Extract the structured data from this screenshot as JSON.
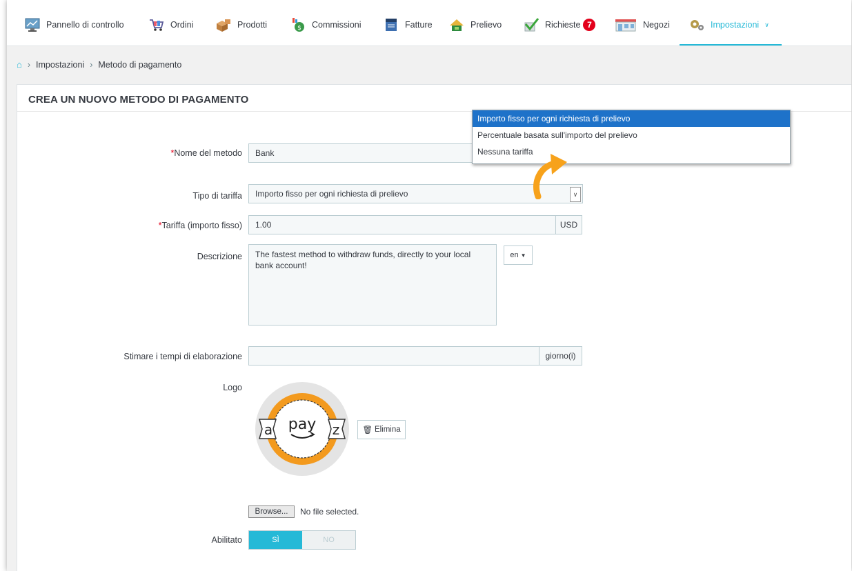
{
  "nav": {
    "items": [
      {
        "label": "Pannello di controllo",
        "icon": "dashboard-icon"
      },
      {
        "label": "Ordini",
        "icon": "cart-icon"
      },
      {
        "label": "Prodotti",
        "icon": "boxes-icon"
      },
      {
        "label": "Commissioni",
        "icon": "money-bag-icon"
      },
      {
        "label": "Fatture",
        "icon": "invoice-icon"
      },
      {
        "label": "Prelievo",
        "icon": "withdraw-icon"
      },
      {
        "label": "Richieste",
        "icon": "checkmark-icon",
        "badge": "7"
      },
      {
        "label": "Negozi",
        "icon": "store-icon"
      },
      {
        "label": "Impostazioni",
        "icon": "gears-icon",
        "active": true
      }
    ]
  },
  "breadcrumb": {
    "items": [
      "Impostazioni",
      "Metodo di pagamento"
    ]
  },
  "panel": {
    "title": "CREA UN NUOVO METODO DI PAGAMENTO"
  },
  "form": {
    "name_label": "Nome del metodo",
    "name_value": "Bank",
    "fee_type_label": "Tipo di tariffa",
    "fee_type_value": "Importo fisso per ogni richiesta di prelievo",
    "fee_label": "Tariffa (importo fisso)",
    "fee_value": "1.00",
    "fee_unit": "USD",
    "desc_label": "Descrizione",
    "desc_value": "The fastest method to withdraw funds, directly to your local bank account!",
    "lang": "en",
    "time_label": "Stimare i tempi di elaborazione",
    "time_value": "",
    "time_unit": "giorno(i)",
    "logo_label": "Logo",
    "logo_text": "pay",
    "logo_left": "a",
    "logo_right": "z",
    "delete_label": "Elimina",
    "browse_label": "Browse...",
    "no_file": "No file selected.",
    "enabled_label": "Abilitato",
    "yes_label": "SÌ",
    "no_label": "NO"
  },
  "dropdown": {
    "options": [
      "Importo fisso per ogni richiesta di prelievo",
      "Percentuale basata sull'importo del prelievo",
      "Nessuna tariffa"
    ],
    "selected_index": 0
  },
  "colors": {
    "accent": "#25b9d7",
    "selected_option": "#1e72c9",
    "badge": "#e3001b",
    "arrow": "#f7a21b"
  }
}
